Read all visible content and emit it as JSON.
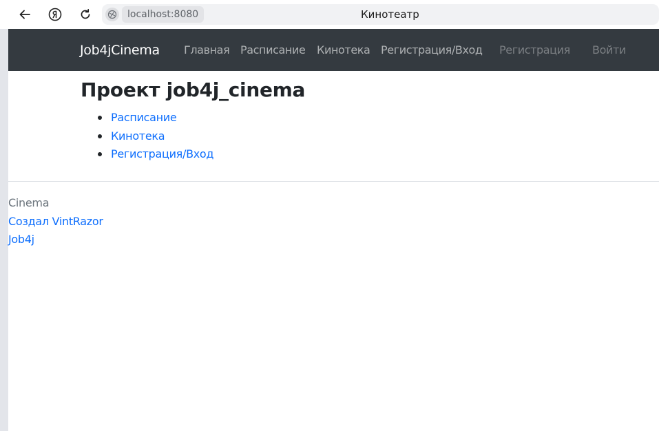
{
  "browser": {
    "url": "localhost:8080",
    "tab_title": "Кинотеатр",
    "icons": [
      "back-arrow-icon",
      "yandex-icon",
      "reload-icon",
      "site-info-icon"
    ]
  },
  "navbar": {
    "brand": "Job4jCinema",
    "links": [
      "Главная",
      "Расписание",
      "Кинотека",
      "Регистрация/Вход"
    ],
    "right_links": [
      "Регистрация",
      "Войти"
    ]
  },
  "main": {
    "title": "Проект job4j_cinema",
    "links": [
      "Расписание",
      "Кинотека",
      "Регистрация/Вход"
    ]
  },
  "footer": {
    "text": "Cinema",
    "author_link": "Создал VintRazor",
    "job4j_link": "Job4j"
  },
  "colors": {
    "navbar_bg": "#343a40",
    "link": "#0d6efd",
    "muted_text": "#6c757d"
  }
}
